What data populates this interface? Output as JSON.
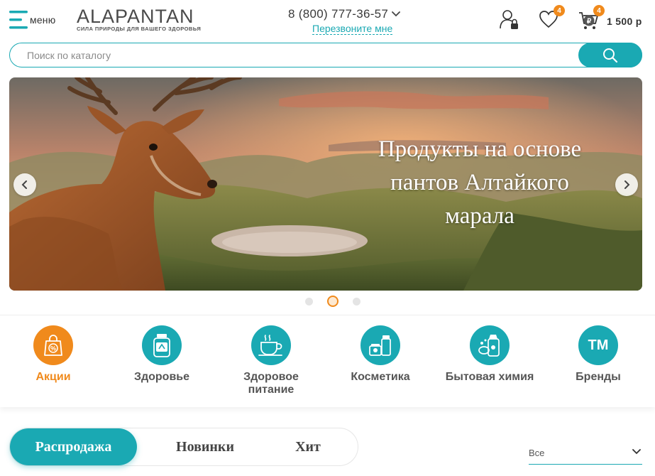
{
  "header": {
    "menu_label": "меню",
    "logo_text": "ALAPANTAN",
    "logo_tagline": "СИЛА ПРИРОДЫ ДЛЯ ВАШЕГО ЗДОРОВЬЯ",
    "phone": "8 (800) 777-36-57",
    "callback_label": "Перезвоните мне",
    "favorites_count": "4",
    "cart_count": "4",
    "cart_sum": "1 500 р"
  },
  "search": {
    "placeholder": "Поиск по каталогу",
    "value": ""
  },
  "banner": {
    "text_line1": "Продукты на основе",
    "text_line2": "пантов Алтайкого",
    "text_line3": "марала",
    "slides_total": 3,
    "active_slide": 2
  },
  "categories": [
    {
      "label": "Акции",
      "icon": "discount-bag-icon",
      "highlight": true
    },
    {
      "label": "Здоровье",
      "icon": "supplement-jar-icon"
    },
    {
      "label": "Здоровое питание",
      "icon": "tea-cup-icon"
    },
    {
      "label": "Косметика",
      "icon": "cosmetics-icon"
    },
    {
      "label": "Бытовая химия",
      "icon": "household-chemicals-icon"
    },
    {
      "label": "Бренды",
      "icon_text": "TM"
    }
  ],
  "tabs": [
    {
      "label": "Распродажа",
      "active": true
    },
    {
      "label": "Новинки"
    },
    {
      "label": "Хит"
    }
  ],
  "filter": {
    "selected": "Все"
  },
  "colors": {
    "accent": "#1aa9b3",
    "highlight": "#f08a1c"
  }
}
